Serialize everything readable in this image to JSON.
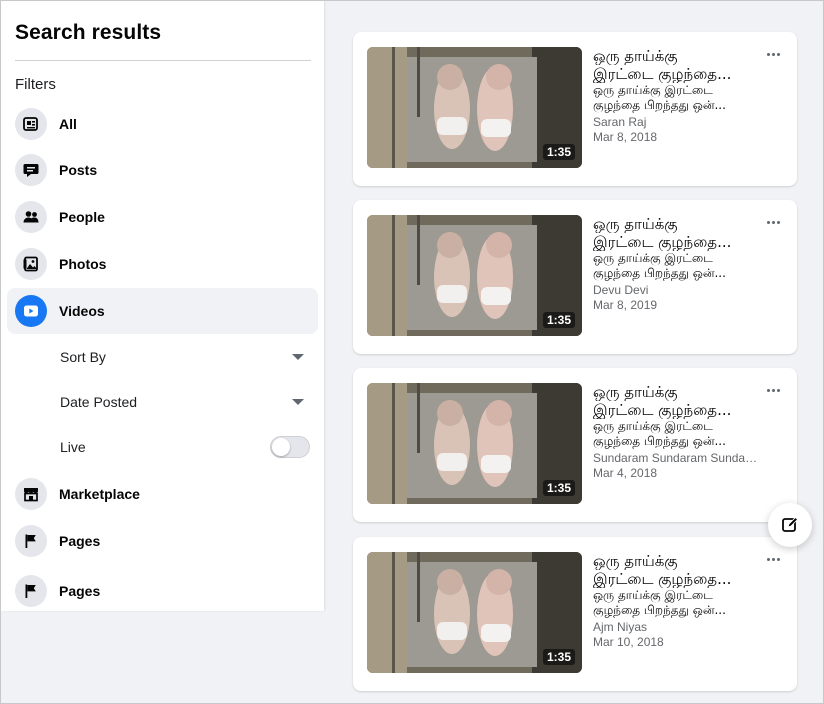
{
  "sidebar": {
    "title": "Search results",
    "filters_label": "Filters",
    "items": [
      {
        "label": "All",
        "icon": "all-icon"
      },
      {
        "label": "Posts",
        "icon": "posts-icon"
      },
      {
        "label": "People",
        "icon": "people-icon"
      },
      {
        "label": "Photos",
        "icon": "photos-icon"
      },
      {
        "label": "Videos",
        "icon": "videos-icon",
        "active": true
      },
      {
        "label": "Marketplace",
        "icon": "marketplace-icon"
      },
      {
        "label": "Pages",
        "icon": "flag-icon"
      },
      {
        "label": "Pages",
        "icon": "flag-icon"
      }
    ],
    "video_filters": {
      "sort_by": "Sort By",
      "date_posted": "Date Posted",
      "live_label": "Live",
      "live_enabled": false
    }
  },
  "results": [
    {
      "title_line1": "ஒரு தாய்க்கு",
      "title_line2": "இரட்டை குழந்தை...",
      "desc_line1": "ஒரு தாய்க்கு இரட்டை",
      "desc_line2": "குழந்தை பிறந்தது ஒன்...",
      "author": "Saran Raj",
      "date": "Mar 8, 2018",
      "duration": "1:35"
    },
    {
      "title_line1": "ஒரு தாய்க்கு",
      "title_line2": "இரட்டை குழந்தை...",
      "desc_line1": "ஒரு தாய்க்கு இரட்டை",
      "desc_line2": "குழந்தை பிறந்தது ஒன்...",
      "author": "Devu Devi",
      "date": "Mar 8, 2019",
      "duration": "1:35"
    },
    {
      "title_line1": "ஒரு தாய்க்கு",
      "title_line2": "இரட்டை குழந்தை...",
      "desc_line1": "ஒரு தாய்க்கு இரட்டை",
      "desc_line2": "குழந்தை பிறந்தது ஒன்...",
      "author": "Sundaram Sundaram Sundara...",
      "date": "Mar 4, 2018",
      "duration": "1:35"
    },
    {
      "title_line1": "ஒரு தாய்க்கு",
      "title_line2": "இரட்டை குழந்தை...",
      "desc_line1": "ஒரு தாய்க்கு இரட்டை",
      "desc_line2": "குழந்தை பிறந்தது ஒன்...",
      "author": "Ajm Niyas",
      "date": "Mar 10, 2018",
      "duration": "1:35"
    }
  ],
  "colors": {
    "accent": "#1877f2",
    "background": "#f0f2f5",
    "secondary_text": "#65676b"
  }
}
